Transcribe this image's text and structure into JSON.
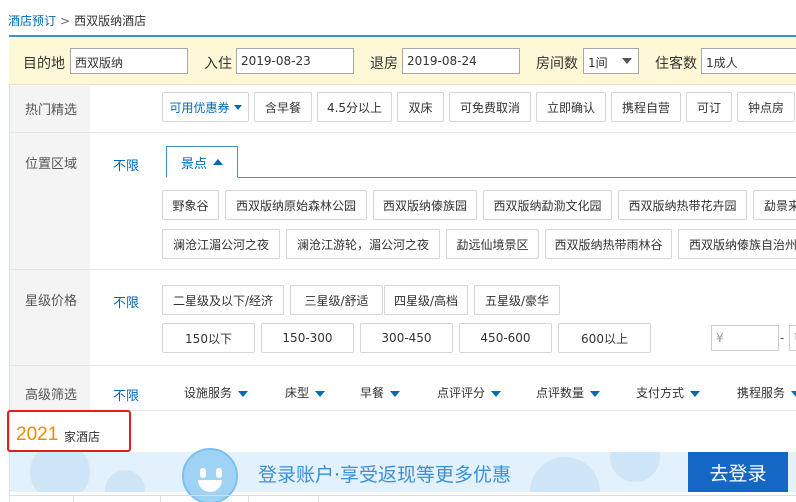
{
  "breadcrumb": {
    "home": "酒店预订",
    "separator": ">",
    "current": "西双版纳酒店"
  },
  "search": {
    "destination_label": "目的地",
    "destination_value": "西双版纳",
    "checkin_label": "入住",
    "checkin_value": "2019-08-23",
    "checkout_label": "退房",
    "checkout_value": "2019-08-24",
    "rooms_label": "房间数",
    "rooms_value": "1间",
    "guests_label": "住客数",
    "guests_value": "1成人"
  },
  "hot_picks": {
    "label": "热门精选",
    "items": [
      "可用优惠券",
      "含早餐",
      "4.5分以上",
      "双床",
      "可免费取消",
      "立即确认",
      "携程自营",
      "可订",
      "钟点房"
    ]
  },
  "location": {
    "label": "位置区域",
    "unlimited": "不限",
    "active_tab": "景点",
    "row1": [
      "野象谷",
      "西双版纳原始森林公园",
      "西双版纳傣族园",
      "西双版纳勐泐文化园",
      "西双版纳热带花卉园",
      "勐景来"
    ],
    "row2": [
      "澜沧江湄公河之夜",
      "澜沧江游轮，湄公河之夜",
      "勐远仙境景区",
      "西双版纳热带雨林谷",
      "西双版纳傣族自治州"
    ]
  },
  "star_price": {
    "label": "星级价格",
    "unlimited": "不限",
    "stars": [
      "二星级及以下/经济",
      "三星级/舒适",
      "四星级/高档",
      "五星级/豪华"
    ],
    "prices": [
      "150以下",
      "150-300",
      "300-450",
      "450-600",
      "600以上"
    ],
    "price_min_placeholder": "¥",
    "price_dash": "-",
    "price_max_placeholder": "¥"
  },
  "advanced": {
    "label": "高级筛选",
    "unlimited": "不限",
    "items": [
      "设施服务",
      "床型",
      "早餐",
      "点评评分",
      "点评数量",
      "支付方式",
      "携程服务"
    ]
  },
  "result": {
    "count": "2021",
    "suffix": "家酒店"
  },
  "banner": {
    "text": "登录账户·享受返现等更多优惠",
    "button": "去登录"
  },
  "colors": {
    "link": "#0069b4",
    "accent_orange": "#f08a00",
    "highlight_red": "#e02020",
    "login_blue": "#1467c4",
    "search_bg": "#fff8d6"
  }
}
